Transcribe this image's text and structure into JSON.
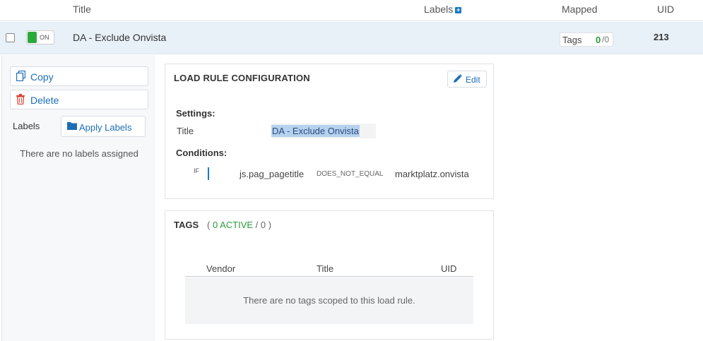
{
  "table_header": {
    "title": "Title",
    "labels": "Labels",
    "labels_add_icon": "plus-icon",
    "mapped": "Mapped",
    "uid": "UID"
  },
  "rule_row": {
    "toggle_state": "ON",
    "title": "DA - Exclude Onvista",
    "tags_label": "Tags",
    "tags_active": "0",
    "tags_total": "/0",
    "uid": "213",
    "colors": {
      "row_bg": "#e8f0f8",
      "toggle_on": "#2aaa3a"
    }
  },
  "actions": {
    "copy_label": "Copy",
    "copy_icon": "copy-icon",
    "delete_label": "Delete",
    "delete_icon": "trash-icon",
    "labels_heading": "Labels",
    "apply_labels": "Apply Labels",
    "apply_icon": "folder-icon",
    "no_labels": "There are no labels assigned"
  },
  "config": {
    "heading": "LOAD RULE CONFIGURATION",
    "edit_label": "Edit",
    "edit_icon": "pencil-icon",
    "settings_label": "Settings:",
    "title_key": "Title",
    "title_value": "DA - Exclude Onvista",
    "conditions_label": "Conditions:",
    "condition": {
      "prefix": "IF",
      "variable": "js.pag_pagetitle",
      "operator": "DOES_NOT_EQUAL",
      "value": "marktplatz.onvista"
    }
  },
  "tags_panel": {
    "heading": "TAGS",
    "open": "(",
    "active": "0 ACTIVE",
    "total": "/ 0",
    "close": ")",
    "columns": [
      "Vendor",
      "Title",
      "UID"
    ],
    "empty_message": "There are no tags scoped to this load rule.",
    "accent": "#2a9a3a"
  }
}
